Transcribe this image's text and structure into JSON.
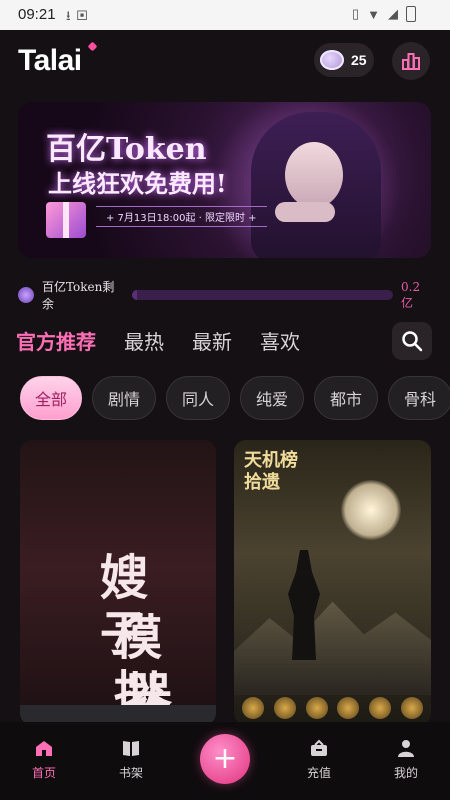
{
  "status_bar": {
    "time": "09:21",
    "left_icons": [
      "download-icon",
      "keyboard-icon"
    ],
    "right_icons": [
      "phone-icon",
      "wifi-icon",
      "signal-icon",
      "battery-icon"
    ]
  },
  "header": {
    "logo": "Talai",
    "coins": "25"
  },
  "banner": {
    "title1": "百亿Token",
    "title2": "上线狂欢免费用!",
    "date_text": "+ 7月13日18:00起 · 限定限时 +"
  },
  "token": {
    "label": "百亿Token剩余",
    "value": "0.2亿",
    "fill_fraction": 0.02
  },
  "tabs": [
    "官方推荐",
    "最热",
    "最新",
    "喜欢"
  ],
  "active_tab": 0,
  "chips": [
    "全部",
    "剧情",
    "同人",
    "纯爱",
    "都市",
    "骨科"
  ],
  "active_chip": 0,
  "cards": [
    {
      "title_lines": [
        "嫂子",
        "模拟",
        "器"
      ]
    },
    {
      "title_lines": [
        "天机榜",
        "拾遗"
      ]
    }
  ],
  "bottom_nav": {
    "home": "首页",
    "shelf": "书架",
    "recharge": "充值",
    "me": "我的"
  },
  "colors": {
    "accent": "#ff6fb5",
    "background": "#141013"
  }
}
